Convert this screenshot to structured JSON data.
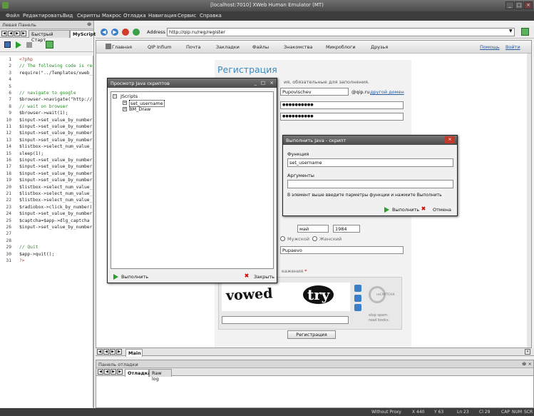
{
  "window": {
    "title": "[localhost:7010] XWeb Human Emulator (MT)"
  },
  "menu": [
    "Файл",
    "Редактировать",
    "Вид",
    "Скрипты",
    "Макрос",
    "Отладка",
    "Навигация",
    "Сервис",
    "Справка"
  ],
  "left_panel": {
    "title": "Левая Панель",
    "tabs": [
      "Быстрый Старт",
      "MyScript"
    ]
  },
  "code_lines": [
    {
      "n": "1",
      "t": "<?php"
    },
    {
      "n": "2",
      "t": "// The following code is require"
    },
    {
      "n": "3",
      "t": "require(\"../Templates/xweb_h"
    },
    {
      "n": "4",
      "t": ""
    },
    {
      "n": "5",
      "t": ""
    },
    {
      "n": "6",
      "t": "// navigate to google"
    },
    {
      "n": "7",
      "t": "$browser->navigate(\"http://qip"
    },
    {
      "n": "8",
      "t": "// wait on browser"
    },
    {
      "n": "9",
      "t": "$browser->wait(1);"
    },
    {
      "n": "10",
      "t": "$input->set_value_by_number"
    },
    {
      "n": "11",
      "t": "$input->set_value_by_number"
    },
    {
      "n": "12",
      "t": "$input->set_value_by_number"
    },
    {
      "n": "13",
      "t": "$input->set_value_by_number"
    },
    {
      "n": "14",
      "t": "$listbox->select_num_value_l"
    },
    {
      "n": "15",
      "t": "sleep(1);"
    },
    {
      "n": "16",
      "t": "$input->set_value_by_number"
    },
    {
      "n": "17",
      "t": "$input->set_value_by_number"
    },
    {
      "n": "18",
      "t": "$input->set_value_by_number"
    },
    {
      "n": "19",
      "t": "$input->set_value_by_number"
    },
    {
      "n": "20",
      "t": "$listbox->select_num_value_l"
    },
    {
      "n": "21",
      "t": "$listbox->select_num_value_l"
    },
    {
      "n": "22",
      "t": "$listbox->select_num_value_l"
    },
    {
      "n": "23",
      "t": "$radiobox->click_by_number("
    },
    {
      "n": "24",
      "t": "$input->set_value_by_number"
    },
    {
      "n": "25",
      "t": "$captcha=$app->dlg_captcha"
    },
    {
      "n": "26",
      "t": "$input->set_value_by_number"
    },
    {
      "n": "27",
      "t": ""
    },
    {
      "n": "28",
      "t": ""
    },
    {
      "n": "29",
      "t": "// Quit"
    },
    {
      "n": "30",
      "t": "$app->quit();"
    },
    {
      "n": "31",
      "t": "?>"
    }
  ],
  "address_bar": {
    "label": "Address",
    "url": "http://qip.ru/reg/register"
  },
  "qip_nav": [
    "Главная",
    "QIP Infium",
    "Почта",
    "Закладки",
    "Файлы",
    "Знакомства",
    "Микроблоги",
    "Друзья"
  ],
  "qip_nav_right": [
    "Помощь",
    "Войти"
  ],
  "registration": {
    "title": "Регистрация",
    "subtitle_fragment": "ия, обязательные для заполнения.",
    "login_value": "Pupovischev",
    "domain_suffix": "@qip.ru",
    "domain_link": "другой домен",
    "password_mask": "●●●●●●●●●●",
    "password_confirm_mask": "●●●●●●●●●●",
    "birth_month": "май",
    "birth_year": "1984",
    "gender_male": "Мужской",
    "gender_female": "Женский",
    "city_value": "Pupaevo",
    "captcha_label_fragment": "кажения",
    "captcha_required_mark": "*",
    "captcha_words": [
      "vowed",
      "try"
    ],
    "recaptcha_lines": [
      "stop spam.",
      "read books."
    ],
    "recaptcha_brand": "reCAPTCHA",
    "submit_button": "Регистрация"
  },
  "browser_tab": "Main",
  "debug_panel": {
    "title": "Панель отладки",
    "tabs": [
      "Отладка",
      "Raw log"
    ]
  },
  "scripts_dialog": {
    "title": "Просмотр Java скриптов",
    "tree_root": "JScripts",
    "tree_items": [
      "set_username",
      "BM_Draw"
    ],
    "run_button": "Выполнить",
    "close_button": "Закрыть"
  },
  "exec_dialog": {
    "title": "Выполнить Java - скрипт",
    "function_label": "Функция",
    "function_value": "set_username",
    "args_label": "Аргументы",
    "args_value": "",
    "hint": "В элемент выше введите парметры функции и нажмите Выполнить",
    "run_button": "Выполнить",
    "cancel_button": "Отмена"
  },
  "status": {
    "proxy": "Without Proxy",
    "x": "X 440",
    "y": "Y 63",
    "ln": "Ln 23",
    "col": "Cl 29",
    "keys": [
      "CAP",
      "NUM",
      "SCR"
    ]
  }
}
